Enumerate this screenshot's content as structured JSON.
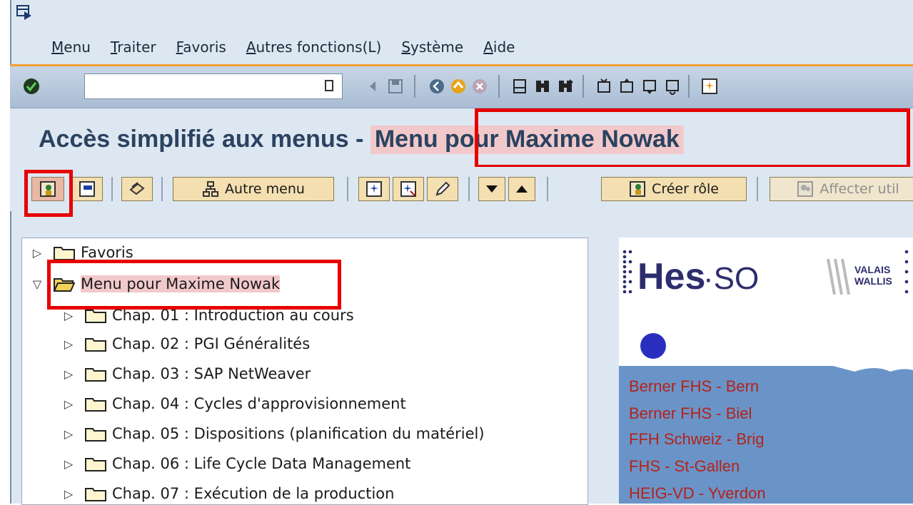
{
  "menubar": {
    "items": [
      "Menu",
      "Traiter",
      "Favoris",
      "Autres fonctions(L)",
      "Système",
      "Aide"
    ]
  },
  "header": {
    "title_prefix": "Accès simplifié aux menus  - ",
    "title_highlight": "Menu pour Maxime Nowak"
  },
  "toolbar2": {
    "autre_menu": "Autre menu",
    "creer_role": "Créer rôle",
    "affecter": "Affecter util"
  },
  "tree": {
    "rows": [
      {
        "label": "Favoris",
        "expanded": false
      },
      {
        "label": "Menu pour Maxime Nowak",
        "expanded": true
      },
      {
        "label": "Chap. 01 : Introduction au cours"
      },
      {
        "label": "Chap. 02 : PGI Généralités"
      },
      {
        "label": "Chap. 03 : SAP NetWeaver"
      },
      {
        "label": "Chap. 04 : Cycles d'approvisionnement"
      },
      {
        "label": "Chap. 05 : Dispositions (planification du matériel)"
      },
      {
        "label": "Chap. 06 : Life Cycle Data Management"
      },
      {
        "label": "Chap. 07 : Exécution de la production"
      }
    ]
  },
  "logo": {
    "hes": "Hes",
    "so": "·SO",
    "valais": "VALAIS",
    "wallis": "WALLIS"
  },
  "schools": [
    "Berner FHS - Bern",
    "Berner FHS - Biel",
    "FFH Schweiz - Brig",
    "FHS - St-Gallen",
    "HEIG-VD - Yverdon"
  ],
  "colors": {
    "highlight_red": "#e60000",
    "title_blue": "#2a4360",
    "link_red": "#b4221a",
    "panel_blue": "#6a94c8"
  }
}
